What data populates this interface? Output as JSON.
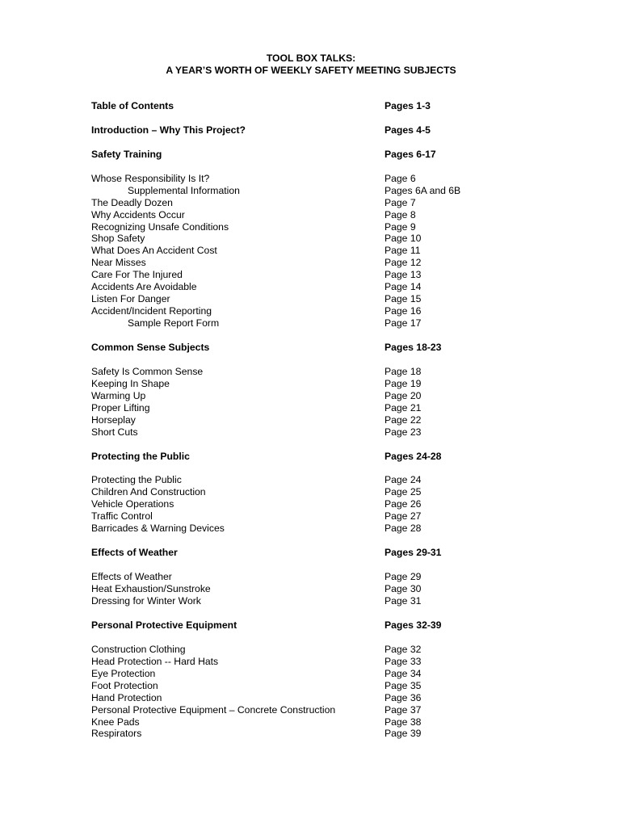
{
  "title": {
    "line1": "TOOL BOX TALKS:",
    "line2": "A YEAR’S WORTH OF WEEKLY SAFETY MEETING SUBJECTS"
  },
  "rows": [
    {
      "type": "heading",
      "label": "Table of Contents",
      "page": "Pages 1-3",
      "gap": 1
    },
    {
      "type": "heading",
      "label": "Introduction – Why This Project?",
      "page": "Pages 4-5",
      "gap": 1
    },
    {
      "type": "heading",
      "label": "Safety Training",
      "page": "Pages 6-17",
      "gap": 1
    },
    {
      "type": "item",
      "label": "Whose Responsibility Is It?",
      "page": "Page 6"
    },
    {
      "type": "subitem",
      "label": "Supplemental Information",
      "page": "Pages 6A and 6B"
    },
    {
      "type": "item",
      "label": "The Deadly Dozen",
      "page": "Page 7"
    },
    {
      "type": "item",
      "label": "Why Accidents Occur",
      "page": "Page 8"
    },
    {
      "type": "item",
      "label": "Recognizing Unsafe Conditions",
      "page": "Page 9"
    },
    {
      "type": "item",
      "label": "Shop Safety",
      "page": "Page 10"
    },
    {
      "type": "item",
      "label": "What Does An Accident Cost",
      "page": "Page 11"
    },
    {
      "type": "item",
      "label": "Near Misses",
      "page": "Page 12"
    },
    {
      "type": "item",
      "label": "Care For The Injured",
      "page": "Page 13"
    },
    {
      "type": "item",
      "label": "Accidents Are Avoidable",
      "page": "Page 14"
    },
    {
      "type": "item",
      "label": "Listen For Danger",
      "page": "Page 15"
    },
    {
      "type": "item",
      "label": "Accident/Incident Reporting",
      "page": "Page 16"
    },
    {
      "type": "subitem",
      "label": "Sample Report Form",
      "page": "Page 17",
      "gap": 1
    },
    {
      "type": "heading",
      "label": "Common Sense Subjects",
      "page": "Pages  18-23",
      "gap": 1
    },
    {
      "type": "item",
      "label": "Safety Is Common Sense",
      "page": "Page 18"
    },
    {
      "type": "item",
      "label": "Keeping In Shape",
      "page": "Page 19"
    },
    {
      "type": "item",
      "label": "Warming Up",
      "page": "Page 20"
    },
    {
      "type": "item",
      "label": "Proper Lifting",
      "page": "Page 21"
    },
    {
      "type": "item",
      "label": "Horseplay",
      "page": "Page 22"
    },
    {
      "type": "item",
      "label": "Short Cuts",
      "page": "Page 23",
      "gap": 1
    },
    {
      "type": "heading",
      "label": "Protecting the Public",
      "page": "Pages  24-28",
      "gap": 1
    },
    {
      "type": "item",
      "label": "Protecting the Public",
      "page": "Page 24"
    },
    {
      "type": "item",
      "label": "Children And Construction",
      "page": "Page 25"
    },
    {
      "type": "item",
      "label": "Vehicle Operations",
      "page": "Page 26"
    },
    {
      "type": "item",
      "label": "Traffic Control",
      "page": "Page 27"
    },
    {
      "type": "item",
      "label": "Barricades & Warning Devices",
      "page": "Page 28",
      "gap": 1
    },
    {
      "type": "heading",
      "label": "Effects of Weather",
      "page": "Pages  29-31",
      "gap": 1
    },
    {
      "type": "item",
      "label": "Effects of Weather",
      "page": "Page 29"
    },
    {
      "type": "item",
      "label": "Heat Exhaustion/Sunstroke",
      "page": "Page 30"
    },
    {
      "type": "item",
      "label": "Dressing for Winter Work",
      "page": "Page 31",
      "gap": 1
    },
    {
      "type": "heading",
      "label": "Personal Protective Equipment",
      "page": "Pages 32-39",
      "gap": 1
    },
    {
      "type": "item",
      "label": "Construction Clothing",
      "page": "Page 32"
    },
    {
      "type": "item",
      "label": "Head Protection -- Hard Hats",
      "page": "Page 33"
    },
    {
      "type": "item",
      "label": "Eye Protection",
      "page": "Page 34"
    },
    {
      "type": "item",
      "label": "Foot Protection",
      "page": "Page 35"
    },
    {
      "type": "item",
      "label": "Hand Protection",
      "page": "Page 36"
    },
    {
      "type": "item",
      "label": "Personal Protective Equipment – Concrete Construction",
      "page": "Page 37"
    },
    {
      "type": "item",
      "label": "Knee Pads",
      "page": "Page 38"
    },
    {
      "type": "item",
      "label": "Respirators",
      "page": "Page 39"
    }
  ]
}
